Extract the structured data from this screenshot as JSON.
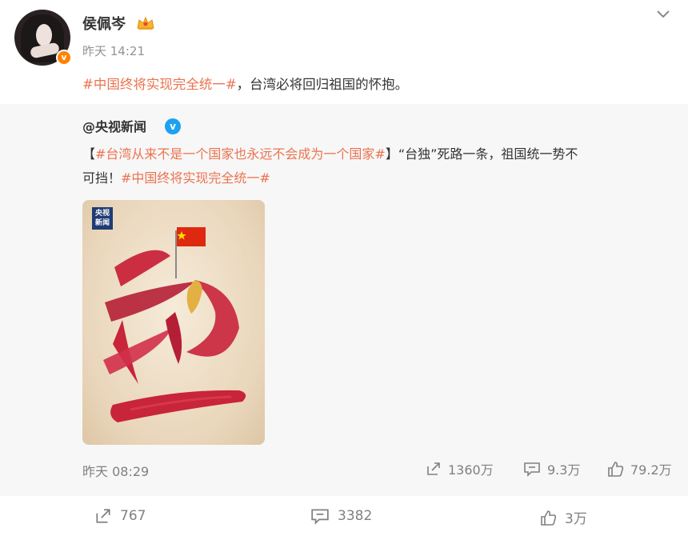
{
  "post": {
    "username": "侯佩岑",
    "time": "昨天 14:21",
    "verified_badge": "v",
    "tag": "#中国终将实现完全统一#",
    "text_rest": "，台湾必将回归祖国的怀抱。"
  },
  "repost": {
    "username": "@央视新闻",
    "verified_badge": "v",
    "text": {
      "open_bracket": "【",
      "tag1": "#台湾从来不是一个国家也永远不会成为一个国家#",
      "mid": "】“台独”死路一条，祖国统一势不",
      "line2_start": "可挡！",
      "tag2": "#中国终将实现完全统一#"
    },
    "image": {
      "logo_line1": "央视",
      "logo_line2": "新闻",
      "char1": "统",
      "char2": "一"
    },
    "time": "昨天 08:29",
    "stats": {
      "reposts": "1360万",
      "comments": "9.3万",
      "likes": "79.2万"
    }
  },
  "footer": {
    "reposts": "767",
    "comments": "3382",
    "likes": "3万"
  },
  "colors": {
    "tag": "#eb7350",
    "vip_badge": "#ff8200",
    "verified_blue": "#1da1f2",
    "repost_bg": "#f7f7f7",
    "brush_red": "#c8243a"
  },
  "icons": [
    "dropdown-chevron-icon",
    "crown-vip-icon",
    "repost-icon",
    "comment-icon",
    "like-icon",
    "flag-icon",
    "taiwan-island-icon"
  ]
}
